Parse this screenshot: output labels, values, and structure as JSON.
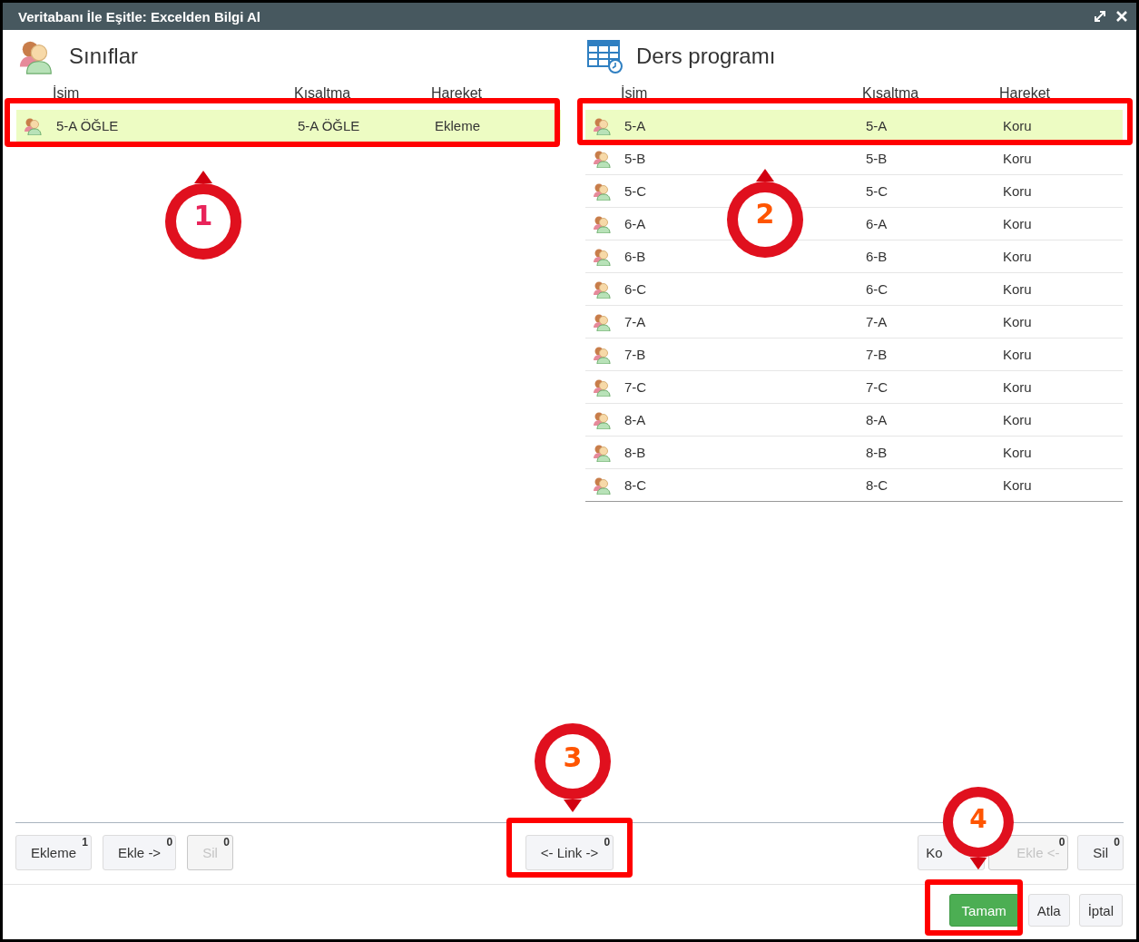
{
  "window": {
    "title": "Veritabanı İle Eşitle: Excelden Bilgi Al"
  },
  "left_panel": {
    "title": "Sınıflar",
    "columns": [
      "İsim",
      "Kısaltma",
      "Hareket"
    ],
    "rows": [
      {
        "name": "5-A ÖĞLE",
        "short": "5-A ÖĞLE",
        "action": "Ekleme",
        "selected": true
      }
    ]
  },
  "right_panel": {
    "title": "Ders programı",
    "columns": [
      "İsim",
      "Kısaltma",
      "Hareket"
    ],
    "rows": [
      {
        "name": "5-A",
        "short": "5-A",
        "action": "Koru",
        "selected": true
      },
      {
        "name": "5-B",
        "short": "5-B",
        "action": "Koru",
        "selected": false
      },
      {
        "name": "5-C",
        "short": "5-C",
        "action": "Koru",
        "selected": false
      },
      {
        "name": "6-A",
        "short": "6-A",
        "action": "Koru",
        "selected": false
      },
      {
        "name": "6-B",
        "short": "6-B",
        "action": "Koru",
        "selected": false
      },
      {
        "name": "6-C",
        "short": "6-C",
        "action": "Koru",
        "selected": false
      },
      {
        "name": "7-A",
        "short": "7-A",
        "action": "Koru",
        "selected": false
      },
      {
        "name": "7-B",
        "short": "7-B",
        "action": "Koru",
        "selected": false
      },
      {
        "name": "7-C",
        "short": "7-C",
        "action": "Koru",
        "selected": false
      },
      {
        "name": "8-A",
        "short": "8-A",
        "action": "Koru",
        "selected": false
      },
      {
        "name": "8-B",
        "short": "8-B",
        "action": "Koru",
        "selected": false
      },
      {
        "name": "8-C",
        "short": "8-C",
        "action": "Koru",
        "selected": false
      }
    ]
  },
  "left_buttons": [
    {
      "label": "Ekleme",
      "count": "1",
      "disabled": false
    },
    {
      "label": "Ekle ->",
      "count": "0",
      "disabled": false
    },
    {
      "label": "Sil",
      "count": "0",
      "disabled": true
    }
  ],
  "center_buttons": [
    {
      "label": "<- Link ->",
      "count": "0",
      "disabled": false
    }
  ],
  "right_buttons": [
    {
      "label": "Ko",
      "disabled": false
    },
    {
      "label": "Ekle <-",
      "count": "0",
      "disabled": true
    },
    {
      "label": "Sil",
      "count": "0",
      "disabled": false
    }
  ],
  "footer_buttons": [
    {
      "label": "Tamam",
      "kind": "primary"
    },
    {
      "label": "Atla",
      "kind": "default"
    },
    {
      "label": "İptal",
      "kind": "default"
    }
  ],
  "callouts": [
    {
      "number": "1",
      "color": "#e8245a"
    },
    {
      "number": "2",
      "color": "#ff5500"
    },
    {
      "number": "3",
      "color": "#ff5500"
    },
    {
      "number": "4",
      "color": "#ff5500"
    }
  ]
}
